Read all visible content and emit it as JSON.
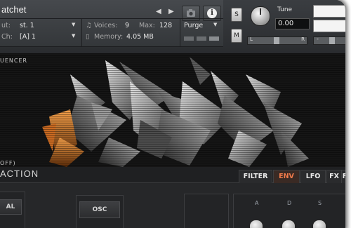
{
  "header": {
    "title": "atchet",
    "out_label": "ut:",
    "out_value": "st. 1",
    "midi_label": "Ch:",
    "midi_value": "[A] 1",
    "voices_label": "Voices:",
    "voices_value": "9",
    "max_label": "Max:",
    "max_value": "128",
    "memory_label": "Memory:",
    "memory_value": "4.05 MB",
    "purge_label": "Purge",
    "solo_label": "S",
    "mute_label": "M",
    "tune_label": "Tune",
    "tune_value": "0.00",
    "pan_left": "L",
    "pan_right": "R",
    "info_icon": "i",
    "camera_icon": "camera-icon"
  },
  "art": {
    "sequencer_label": "UENCER",
    "off_label": "OFF)"
  },
  "bottom": {
    "section_title": "ACTION",
    "tabs": [
      {
        "label": "FILTER",
        "active": false
      },
      {
        "label": "ENV",
        "active": true
      },
      {
        "label": "LFO",
        "active": false
      },
      {
        "label": "FX",
        "active": false
      },
      {
        "label": "F",
        "active": false
      }
    ],
    "left_button_label": "AL",
    "osc_button_label": "OSC",
    "env_labels": [
      "A",
      "D",
      "S"
    ]
  },
  "colors": {
    "accent_orange": "#f07a4a",
    "header_bg": "#3a3d41",
    "panel_bg": "#262729"
  }
}
